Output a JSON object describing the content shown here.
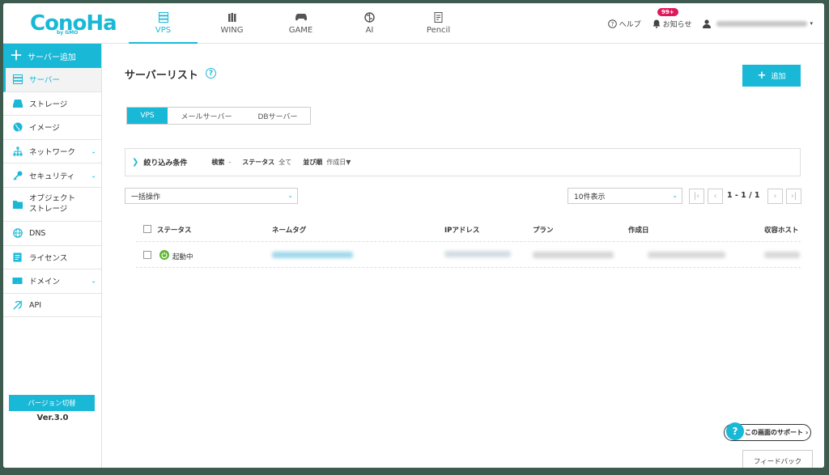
{
  "colors": {
    "accent": "#19b8d7",
    "badge": "#e0185b",
    "running": "#5cb531"
  },
  "header": {
    "logo": "ConoHa",
    "logo_sub": "by GMO",
    "nav": [
      {
        "label": "VPS",
        "icon": "server-icon"
      },
      {
        "label": "WING",
        "icon": "wing-icon"
      },
      {
        "label": "GAME",
        "icon": "gamepad-icon"
      },
      {
        "label": "AI",
        "icon": "brain-icon"
      },
      {
        "label": "Pencil",
        "icon": "pencil-icon"
      }
    ],
    "help": "ヘルプ",
    "notifications": "お知らせ",
    "badge": "99+"
  },
  "sidebar": {
    "add": "サーバー追加",
    "items": [
      {
        "label": "サーバー",
        "icon": "server-icon"
      },
      {
        "label": "ストレージ",
        "icon": "storage-icon"
      },
      {
        "label": "イメージ",
        "icon": "globe-icon"
      },
      {
        "label": "ネットワーク",
        "icon": "network-icon"
      },
      {
        "label": "セキュリティ",
        "icon": "key-icon"
      },
      {
        "label": "オブジェクト",
        "label2": "ストレージ",
        "icon": "folder-icon"
      },
      {
        "label": "DNS",
        "icon": "dns-globe-icon"
      },
      {
        "label": "ライセンス",
        "icon": "license-icon"
      },
      {
        "label": "ドメイン",
        "icon": "domain-icon"
      },
      {
        "label": "API",
        "icon": "api-icon"
      }
    ],
    "version_switch": "バージョン切替",
    "version": "Ver.3.0"
  },
  "main": {
    "title": "サーバーリスト",
    "add_button": "追加",
    "tabs": [
      "VPS",
      "メールサーバー",
      "DBサーバー"
    ],
    "filter": {
      "title": "絞り込み条件",
      "search_key": "検索",
      "search_val": "-",
      "status_key": "ステータス",
      "status_val": "全て",
      "sort_key": "並び順",
      "sort_val": "作成日▼"
    },
    "bulk_select": "一括操作",
    "per_page_select": "10件表示",
    "page_info": "1 - 1 / 1",
    "columns": [
      "ステータス",
      "ネームタグ",
      "IPアドレス",
      "プラン",
      "作成日",
      "収容ホスト"
    ],
    "rows": [
      {
        "status": "起動中"
      }
    ]
  },
  "support": "この画面のサポート",
  "feedback": "フィードバック"
}
